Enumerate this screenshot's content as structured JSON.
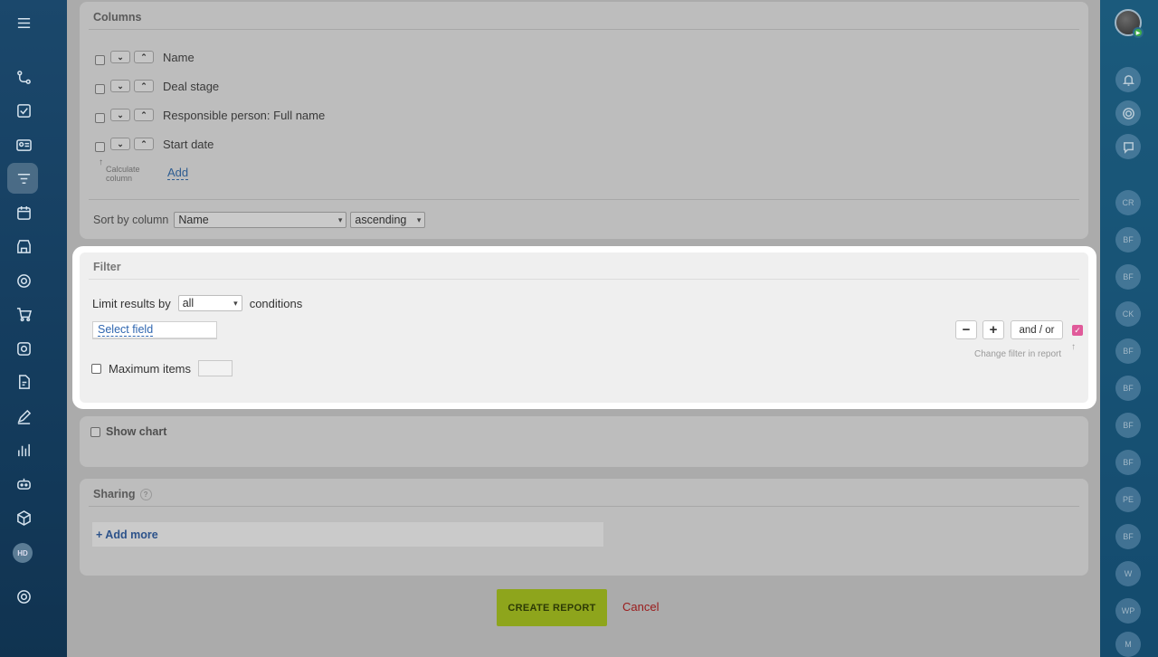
{
  "columns_panel": {
    "title": "Columns",
    "items": [
      {
        "label": "Name"
      },
      {
        "label": "Deal stage"
      },
      {
        "label": "Responsible person: Full name"
      },
      {
        "label": "Start date"
      }
    ],
    "calculate_label_1": "Calculate",
    "calculate_label_2": "column",
    "add_label": "Add",
    "sort_label": "Sort by column",
    "sort_field": "Name",
    "sort_order": "ascending"
  },
  "filter_panel": {
    "title": "Filter",
    "limit_label": "Limit results by",
    "limit_value": "all",
    "conditions_label": "conditions",
    "select_field_label": "Select field",
    "minus_label": "−",
    "plus_label": "+",
    "andor_label": "and / or",
    "change_filter_label": "Change filter in report",
    "max_items_label": "Maximum items"
  },
  "chart_panel": {
    "show_chart_label": "Show chart"
  },
  "sharing_panel": {
    "title": "Sharing",
    "help_label": "?",
    "add_more_label": "+ Add more"
  },
  "actions": {
    "create_label": "CREATE REPORT",
    "cancel_label": "Cancel"
  },
  "left_sidebar": {
    "icons": [
      "menu-icon",
      "flow-icon",
      "task-check-icon",
      "contact-card-icon",
      "filter-icon",
      "calendar-icon",
      "store-icon",
      "target-icon",
      "cart-icon",
      "box-icon",
      "document-edit-icon",
      "pen-icon",
      "bar-chart-icon",
      "robot-icon",
      "package-icon",
      "settings-icon"
    ],
    "hd_badge": "HD"
  },
  "right_sidebar": {
    "avatars": [
      "CR",
      "BF",
      "BF",
      "CK",
      "BF",
      "BF",
      "BF",
      "BF",
      "PE",
      "BF",
      "W",
      "WP",
      "M"
    ]
  },
  "colors": {
    "accent_green": "#8ea51c",
    "cancel_red": "#9a1b1b",
    "link_blue": "#2f66b0",
    "checkbox_pink": "#e05a9a"
  }
}
